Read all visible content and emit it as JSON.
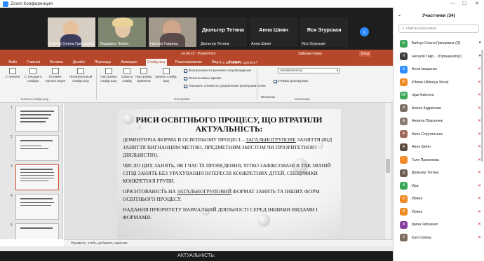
{
  "window": {
    "title": "Zoom Конференция",
    "controls": [
      "—",
      "☐",
      "✕"
    ]
  },
  "gallery": {
    "tiles": [
      {
        "name": "Бабчук Олена Григорівна",
        "type": "video"
      },
      {
        "name": "Людмила Чабан",
        "type": "video"
      },
      {
        "name": "Наталя Гаврищ",
        "type": "video"
      },
      {
        "name": "Дюльгер Тетяна",
        "label": "Дюльгер Тетяна",
        "type": "name"
      },
      {
        "name": "Анна Шиян",
        "label": "Анна Шиян",
        "type": "name"
      },
      {
        "name": "Яся Згурская",
        "label": "Яся Згурская",
        "type": "name"
      }
    ],
    "next": "›"
  },
  "ppt": {
    "title": "14.04.22 - PowerPoint",
    "tool_label": "Работа с рисунками",
    "user": "Зайкова Ганна",
    "sign_in": "Вход",
    "tabs": [
      "Файл",
      "Главная",
      "Вставка",
      "Дизайн",
      "Переходы",
      "Анимация",
      "Слайд-шоу",
      "Рецензирование",
      "Вид",
      "Формат"
    ],
    "active_tab": "Слайд-шоу",
    "tell_me": "Что вы хотите сделать?",
    "ribbon": {
      "btn_from_start": "С начала",
      "btn_from_current": "С текущего слайда",
      "btn_online": "Онлайн-презентация",
      "btn_custom": "Произвольный слайд-шоу",
      "btn_setup": "Настройка слайд-шоу",
      "btn_hide": "Скрыть слайд",
      "btn_rehearse": "Настройка времени",
      "btn_record": "Запись слайд-шоу",
      "group_start": "Начать слайд-шоу",
      "group_setup": "Настройка",
      "group_monitors": "Мониторы",
      "chk_narration": "Воспроизвести речевое сопровождение",
      "chk_timings": "Использовать время",
      "chk_media": "Показать элементы управления проигрывателем",
      "monitor_label": "Монитор:",
      "monitor_value": "Автоматически",
      "presenter_view": "Режим докладчика"
    },
    "thumbs": [
      {
        "num": "1",
        "text": "НАЛАГОДЖЕННЯ ВЗАЄМОДІЇ"
      },
      {
        "num": "2",
        "text": "ДЕМОНСТРАЦІЯ ЗАНЯТЬ"
      },
      {
        "num": "3",
        "text": "РИСИ ОСВІТНЬОГО ПРОЦЕСУ"
      },
      {
        "num": "4",
        "text": "КОНСТРУКТИВНА ВЗАЄМОДІЯ"
      },
      {
        "num": "5",
        "text": "ДИФЕРЕНЦІЙОВАНИЙ ПІДХІД"
      }
    ],
    "slide": {
      "title": "РИСИ ОСВІТНЬОГО ПРОЦЕСУ, ЩО ВТРАТИЛИ АКТУАЛЬНІСТЬ:",
      "p1_a": "Домінуюча форма в освітньому процесі – ",
      "p1_u": "загальногрупове",
      "p1_b": " заняття (від заняття вигнанцям метою, предметним змістом чи пріоритетною діяльністю).",
      "p2": "Число цих занять, як і час їх проведення, чітко зафіксовані в так званій сітці занять без урахування інтересів конкретних дітей, специфіки конкретної групи.",
      "p3_a": "Орієнтованість на ",
      "p3_u": "загальногруповий",
      "p3_b": " формат занять та інших форм освітнього процесу.",
      "p4": "Надання пріоритету навчальній діяльності серед іншими видами і формами."
    },
    "notes_placeholder": "Нажмите, чтобы добавить заметки"
  },
  "below_caption": "АКТУАЛЬНІСТЬ:",
  "participants": {
    "header": "Участники (34)",
    "search_placeholder": "Найти участника",
    "list": [
      {
        "initial": "Б",
        "color": "#3aa655",
        "name": "Бабчук Олена Григорівна (Я)",
        "mic": "on"
      },
      {
        "initial": "Н",
        "color": "#3c3c3c",
        "name": "Наталія Гавр... (Организатор)",
        "mic": "on"
      },
      {
        "initial": "А",
        "color": "#2d8cff",
        "name": "Алла Іващенко",
        "mic": "off"
      },
      {
        "initial": "IV",
        "color": "#f08a24",
        "name": "iPhone Viktoriya Storoj",
        "mic": "off"
      },
      {
        "initial": "OF",
        "color": "#3aa655",
        "name": "olga fedorova",
        "mic": "off"
      },
      {
        "initial": "А",
        "color": "#7b6f66",
        "name": "Алена Кудрясова",
        "mic": "off"
      },
      {
        "initial": "А",
        "color": "#8a7a70",
        "name": "Анжела Прасенюк",
        "mic": "off"
      },
      {
        "initial": "А",
        "color": "#a06a5a",
        "name": "Анна Струтинська",
        "mic": "off"
      },
      {
        "initial": "А",
        "color": "#5a4a40",
        "name": "Анна Шиян",
        "mic": "off"
      },
      {
        "initial": "Г",
        "color": "#f08a24",
        "name": "Галя Прокопова",
        "mic": "off"
      },
      {
        "initial": "Д",
        "color": "#6a5a50",
        "name": "Дюльгер Тетяна",
        "mic": "off"
      },
      {
        "initial": "И",
        "color": "#3aa655",
        "name": "Ира",
        "mic": "off"
      },
      {
        "initial": "И",
        "color": "#f08a24",
        "name": "Ирина",
        "mic": "off"
      },
      {
        "initial": "И",
        "color": "#f08a24",
        "name": "Ирина",
        "mic": "off"
      },
      {
        "initial": "И",
        "color": "#8a3f9e",
        "name": "Ірина Черненко",
        "mic": "off"
      },
      {
        "initial": "К",
        "color": "#7a6a60",
        "name": "Катя Сёмка",
        "mic": "off"
      }
    ]
  }
}
